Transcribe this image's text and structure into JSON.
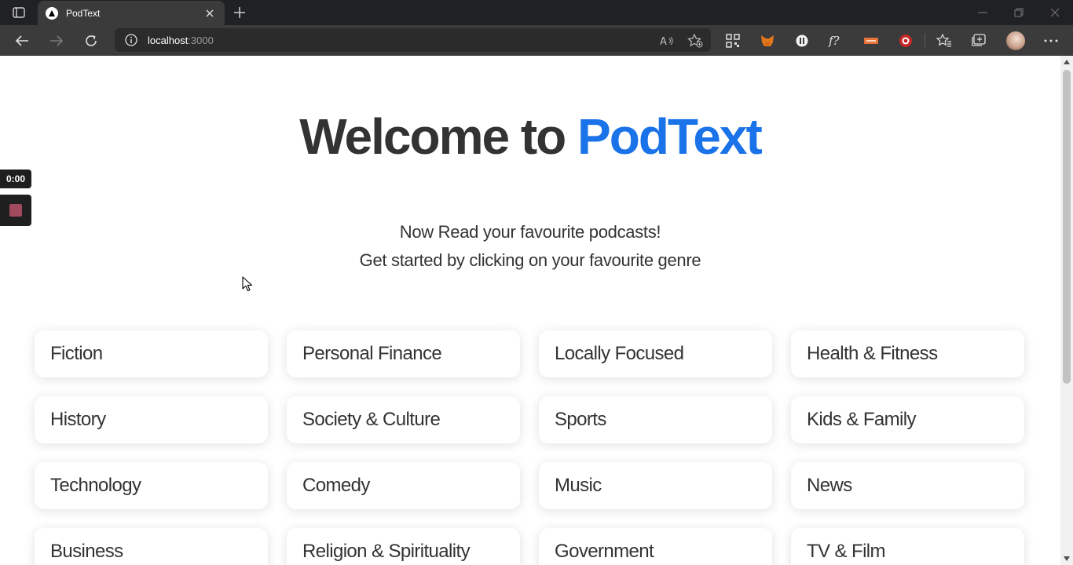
{
  "browser": {
    "tab": {
      "title": "PodText"
    },
    "address": {
      "host": "localhost",
      "port": ":3000"
    }
  },
  "page": {
    "headline": {
      "prefix": "Welcome to ",
      "brand": "PodText"
    },
    "tagline": {
      "line1": "Now Read your favourite podcasts!",
      "line2": "Get started by clicking on your favourite genre"
    },
    "genres": [
      "Fiction",
      "Personal Finance",
      "Locally Focused",
      "Health & Fitness",
      "History",
      "Society & Culture",
      "Sports",
      "Kids & Family",
      "Technology",
      "Comedy",
      "Music",
      "News",
      "Business",
      "Religion & Spirituality",
      "Government",
      "TV & Film"
    ],
    "brand_color": "#1a73e8"
  },
  "recorder": {
    "timer": "0:00"
  }
}
